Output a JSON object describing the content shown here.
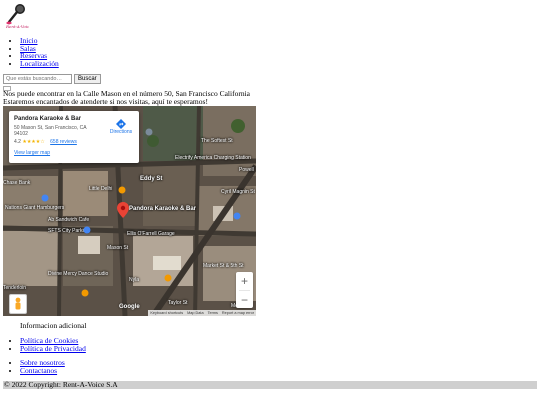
{
  "brand": {
    "logo_text": "Rent-A-Voice",
    "logo_icon": "microphone-icon"
  },
  "nav": {
    "items": [
      "Inicio",
      "Salas",
      "Reservas",
      "Localización"
    ]
  },
  "search": {
    "placeholder": "Que estás buscando…",
    "button_label": "Buscar"
  },
  "address": {
    "line1": "Nos puede encontrar en la Calle Mason en el número 50, San Francisco California",
    "line2": "Estaremos encantados de atenderte si nos visitas, aquí te esperamos!"
  },
  "map": {
    "place_title": "Pandora Karaoke & Bar",
    "place_address": "50 Mason St, San Francisco, CA 94102",
    "rating": "4.2",
    "stars": "★★★★☆",
    "reviews": "658 reviews",
    "larger_map": "View larger map",
    "directions": "Directions",
    "zoom_in": "+",
    "zoom_out": "−",
    "google_logo": "Google",
    "labels": {
      "pandora": "Pandora Karaoke & Bar",
      "little_delhi": "Little Delhi",
      "eddy": "Eddy St",
      "cyril": "Cyril Magnin St",
      "market": "Market St & 5th St",
      "ellis_parking": "Ellis O'Farrell Garage",
      "the_softest": "The Softest St",
      "powell": "Powell",
      "mason": "Mason St",
      "nyla": "Nyla",
      "city_parking": "SFTS City Parking",
      "divine": "Divine Mercy Dance Studio",
      "tenderloin": "Tenderloin",
      "ab_cafe": "Ab Sandwich Cafe",
      "nations": "Nations Giant Hamburgers",
      "chase_bank": "Chase Bank",
      "east_charging": "Electrify America Charging Station",
      "mercer": "Mercer",
      "s_st": "Taylor St"
    },
    "attribution": {
      "shortcuts": "Keyboard shortcuts",
      "map_data": "Map Data",
      "terms": "Terms",
      "report": "Report a map error"
    },
    "colors": {
      "pin": "#ea4335",
      "link": "#1a73e8",
      "star": "#f4b400"
    }
  },
  "additional_info": "Informacion adicional",
  "legal_links": [
    "Política de Cookies",
    "Política de Privacidad"
  ],
  "about_links": [
    "Sobre nosotros",
    "Contactanos"
  ],
  "footer": {
    "copyright": "© 2022 Copyright: Rent-A-Voice S.A"
  }
}
